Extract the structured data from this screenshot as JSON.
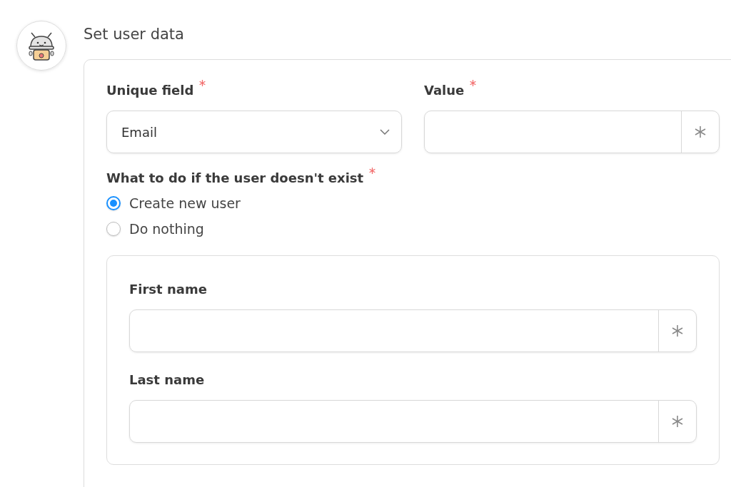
{
  "node": {
    "title": "Set user data"
  },
  "unique_field": {
    "label": "Unique field",
    "required": true,
    "value": "Email"
  },
  "value_field": {
    "label": "Value",
    "required": true
  },
  "missing_user": {
    "label": "What to do if the user doesn't exist",
    "required": true,
    "options": [
      {
        "label": "Create new user",
        "selected": true
      },
      {
        "label": "Do nothing",
        "selected": false
      }
    ]
  },
  "new_user_fields": [
    {
      "label": "First name"
    },
    {
      "label": "Last name"
    }
  ]
}
